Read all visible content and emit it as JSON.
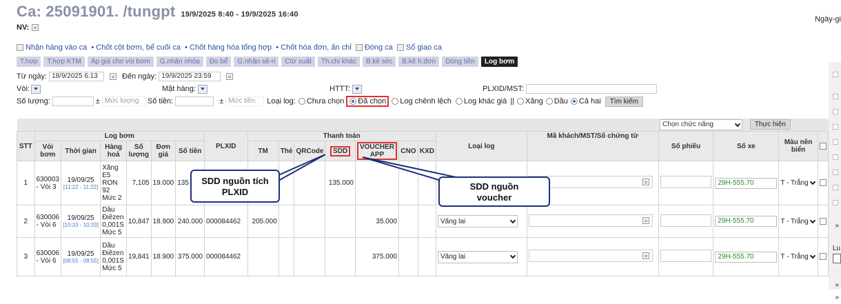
{
  "header": {
    "title": "Ca: 25091901. /tungpt",
    "time_range": "19/9/2025 8:40 - 19/9/2025 16:40",
    "nv_label": "NV:",
    "right_label": "Ngày-gi"
  },
  "links": [
    "Nhận hàng vào ca",
    "• Chốt cột bơm, bể cuối ca",
    "• Chốt hàng hóa tổng hợp",
    "• Chốt hóa đơn, ấn chỉ",
    "Đóng ca",
    "Sổ giao ca"
  ],
  "tabs": [
    "T.hợp",
    "T.hợp KTM",
    "Áp giá cho vòi bơm",
    "G.nhận nhóa",
    "Đo bể",
    "G.nhận sê-ri",
    "Ctừ xuất",
    "Th.chi khác",
    "B.kê séc",
    "B.kê h.đơn",
    "Dòng tiền",
    "Log bơm"
  ],
  "filters": {
    "tu_ngay_label": "Từ ngày:",
    "tu_ngay": "18/9/2025 6:13",
    "den_ngay_label": "Đến ngày:",
    "den_ngay": "19/9/2025 23:59",
    "voi_label": "Vòi:",
    "mat_hang_label": "Mặt hàng:",
    "httt_label": "HTTT:",
    "plxid_label": "PLXID/MST:",
    "so_luong_label": "Số lượng:",
    "pm1": "±",
    "muc_luong_ph": "Mức lượng",
    "so_tien_label": "Số tiền:",
    "pm2": "±",
    "muc_tien_ph": "Mức tiền",
    "loai_log_label": "Loại log:",
    "r_chua_chon": "Chưa chọn",
    "r_da_chon": "Đã chọn",
    "r_log_chenh_lech": "Log chênh lệch",
    "r_log_khac_gia": "Log khác giá",
    "sep": "||",
    "r_xang": "Xăng",
    "r_dau": "Dầu",
    "r_ca_hai": "Cả hai",
    "search_button": "Tìm kiếm",
    "chon_chuc_nang": "Chọn chức năng",
    "thuc_hien": "Thực hiện"
  },
  "table": {
    "headers": {
      "stt": "STT",
      "log_bom": "Log bơm",
      "voi_bom": "Vòi bơm",
      "thoi_gian": "Thời gian",
      "hang_hoa": "Hàng hoá",
      "so_luong": "Số lượng",
      "don_gia": "Đơn giá",
      "so_tien": "Số tiền",
      "plxid": "PLXID",
      "thanh_toan": "Thanh toán",
      "tm": "TM",
      "the": "Thẻ",
      "qrcode": "QRCode",
      "sdd": "SDD",
      "voucher": "VOUCHER APP",
      "cno": "CNO",
      "kxd": "KXD",
      "loai_log": "Loại log",
      "ma_khach": "Mã khách/MST/Số chứng từ",
      "so_phieu": "Số phiếu",
      "so_xe": "Số xe",
      "mau_nen": "Màu nền biển"
    },
    "rows": [
      {
        "stt": "1",
        "voi": "630003 - Vòi 3",
        "date": "19/09/25",
        "time": "[11:22 - 11:22]",
        "hang": "Xăng E5 RON 92 Mức 2",
        "sl": "7,105",
        "dg": "19.000",
        "st": "135",
        "plxid": "",
        "tm": "",
        "sdd": "135.000",
        "voucher": "",
        "loai": "V",
        "so_xe": "29H-555.70",
        "mau": "T - Trắng"
      },
      {
        "stt": "2",
        "voi": "630006 - Vòi 6",
        "date": "19/09/25",
        "time": "[10:33 - 10:33]",
        "hang": "Dầu Điêzen 0,001S Mức 5",
        "sl": "10,847",
        "dg": "18.900",
        "st": "240.000",
        "plxid": "000084462",
        "tm": "205.000",
        "sdd": "",
        "voucher": "35.000",
        "loai": "Vãng lai",
        "so_xe": "29H-555.70",
        "mau": "T - Trắng"
      },
      {
        "stt": "3",
        "voi": "630006 - Vòi 6",
        "date": "19/09/25",
        "time": "[08:55 - 08:55]",
        "hang": "Dầu Điêzen 0,001S Mức 5",
        "sl": "19,841",
        "dg": "18.900",
        "st": "375.000",
        "plxid": "000084462",
        "tm": "",
        "sdd": "",
        "voucher": "375.000",
        "loai": "Vãng lai",
        "so_xe": "29H-555.70",
        "mau": "T - Trắng"
      }
    ]
  },
  "callouts": {
    "sdd_plxid": "SDD nguồn tích PLXID",
    "sdd_voucher": "SDD nguồn voucher"
  },
  "side": {
    "label_lu": "Lu",
    "arrows": "»"
  },
  "colors": {
    "accent_red": "#e03030",
    "callout_border": "#1f2f7a",
    "plate_green": "#2a8a2a",
    "tab_bg": "#d0d4e4"
  }
}
